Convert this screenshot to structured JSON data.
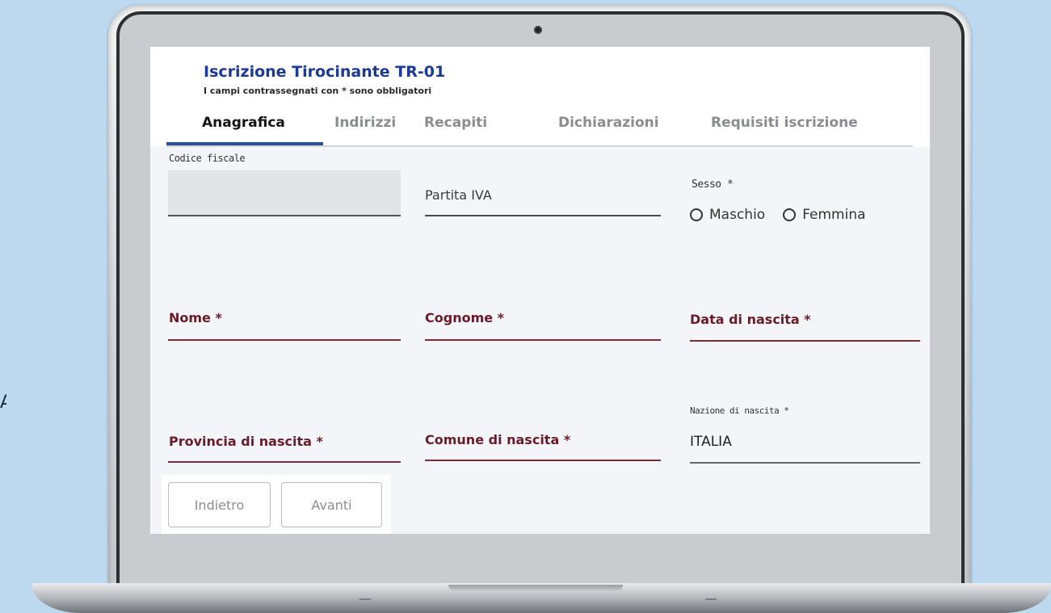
{
  "background": {
    "stray_char": "A."
  },
  "header": {
    "title": "Iscrizione Tirocinante TR-01",
    "subtitle": "I campi contrassegnati con * sono obbligatori"
  },
  "tabs": [
    {
      "label": "Anagrafica",
      "active": true
    },
    {
      "label": "Indirizzi",
      "active": false
    },
    {
      "label": "Recapiti",
      "active": false
    },
    {
      "label": "Dichiarazioni",
      "active": false
    },
    {
      "label": "Requisiti iscrizione",
      "active": false
    }
  ],
  "fields": {
    "codice_fiscale": {
      "label": "Codice fiscale",
      "value": ""
    },
    "partita_iva": {
      "label": "Partita IVA",
      "value": ""
    },
    "sesso": {
      "label": "Sesso *",
      "options": [
        "Maschio",
        "Femmina"
      ]
    },
    "nome": {
      "label": "Nome *",
      "value": ""
    },
    "cognome": {
      "label": "Cognome *",
      "value": ""
    },
    "data_nascita": {
      "label": "Data di nascita *",
      "value": ""
    },
    "provincia_nascita": {
      "label": "Provincia di nascita *",
      "value": ""
    },
    "comune_nascita": {
      "label": "Comune di nascita *",
      "value": ""
    },
    "nazione_nascita": {
      "label": "Nazione di nascita *",
      "value": "ITALIA"
    }
  },
  "buttons": {
    "back": "Indietro",
    "next": "Avanti"
  },
  "colors": {
    "accent": "#1c3a93",
    "required_label": "#6b1a28",
    "tab_underline": "#2b4e8f"
  }
}
